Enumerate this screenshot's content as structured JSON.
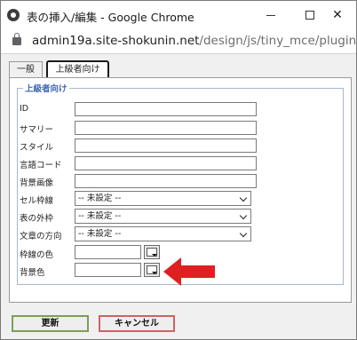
{
  "window": {
    "title": "表の挿入/編集 - Google Chrome",
    "controls": {
      "minimize": "",
      "maximize": "",
      "close": "✕"
    }
  },
  "address_bar": {
    "host": "admin19a.site-shokunin.net",
    "path": "/design/js/tiny_mce/plugin..."
  },
  "tabs": [
    {
      "label": "一般",
      "active": false
    },
    {
      "label": "上級者向け",
      "active": true
    }
  ],
  "fieldset": {
    "legend": "上級者向け",
    "fields": [
      {
        "label": "ID",
        "type": "text",
        "value": ""
      },
      {
        "label": "サマリー",
        "type": "text",
        "value": ""
      },
      {
        "label": "スタイル",
        "type": "text",
        "value": ""
      },
      {
        "label": "言語コード",
        "type": "text",
        "value": ""
      },
      {
        "label": "背景画像",
        "type": "text",
        "value": ""
      },
      {
        "label": "セル枠線",
        "type": "select",
        "value": "-- 未設定 --"
      },
      {
        "label": "表の外枠",
        "type": "select",
        "value": "-- 未設定 --"
      },
      {
        "label": "文章の方向",
        "type": "select",
        "value": "-- 未設定 --"
      },
      {
        "label": "枠線の色",
        "type": "color",
        "value": ""
      },
      {
        "label": "背景色",
        "type": "color",
        "value": ""
      }
    ]
  },
  "buttons": {
    "update": "更新",
    "cancel": "キャンセル"
  },
  "colors": {
    "legend": "#3a66b0",
    "annotation_arrow": "#e02020",
    "update_border": "#7e9d57",
    "cancel_border": "#c96565"
  },
  "icons": [
    "app-icon",
    "lock-icon",
    "color-picker-icon",
    "chevron-down-icon",
    "red-arrow-annotation"
  ]
}
